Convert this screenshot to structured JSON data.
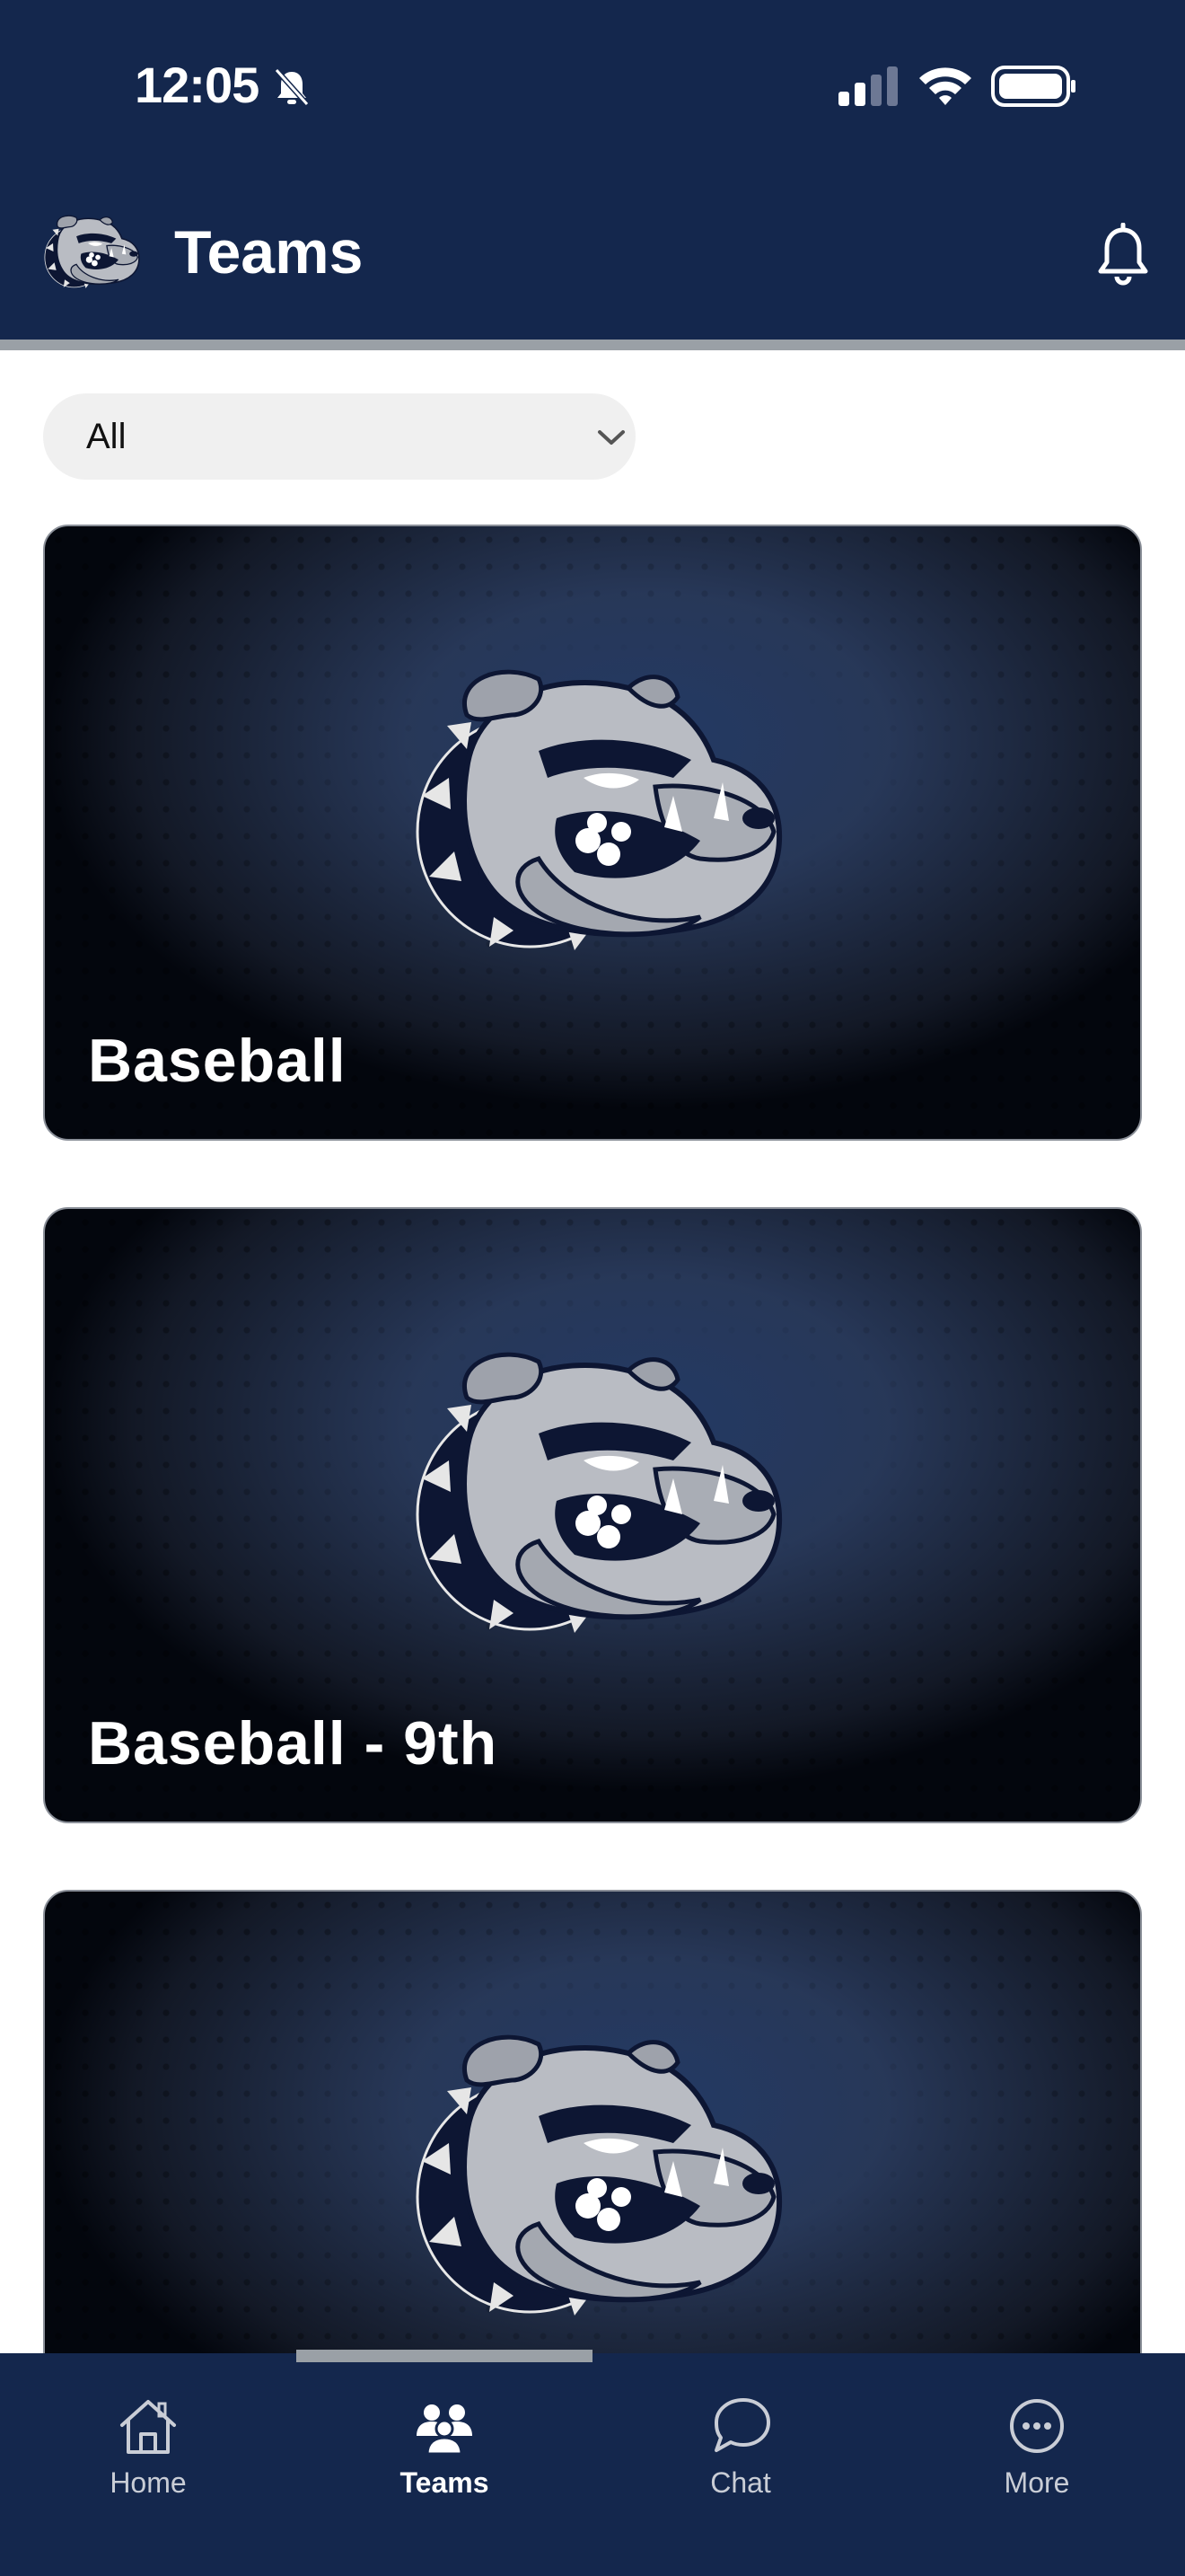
{
  "status_bar": {
    "time": "12:05"
  },
  "header": {
    "title": "Teams"
  },
  "filter": {
    "selected": "All"
  },
  "teams": [
    {
      "name": "Baseball"
    },
    {
      "name": "Baseball - 9th"
    },
    {
      "name": ""
    }
  ],
  "tabs": [
    {
      "label": "Home",
      "icon": "home-icon"
    },
    {
      "label": "Teams",
      "icon": "teams-icon",
      "active": true
    },
    {
      "label": "Chat",
      "icon": "chat-icon"
    },
    {
      "label": "More",
      "icon": "more-icon"
    }
  ],
  "colors": {
    "navy": "#14274d",
    "chip": "#f0f0f0",
    "mascot_gray": "#b9bcc3"
  }
}
